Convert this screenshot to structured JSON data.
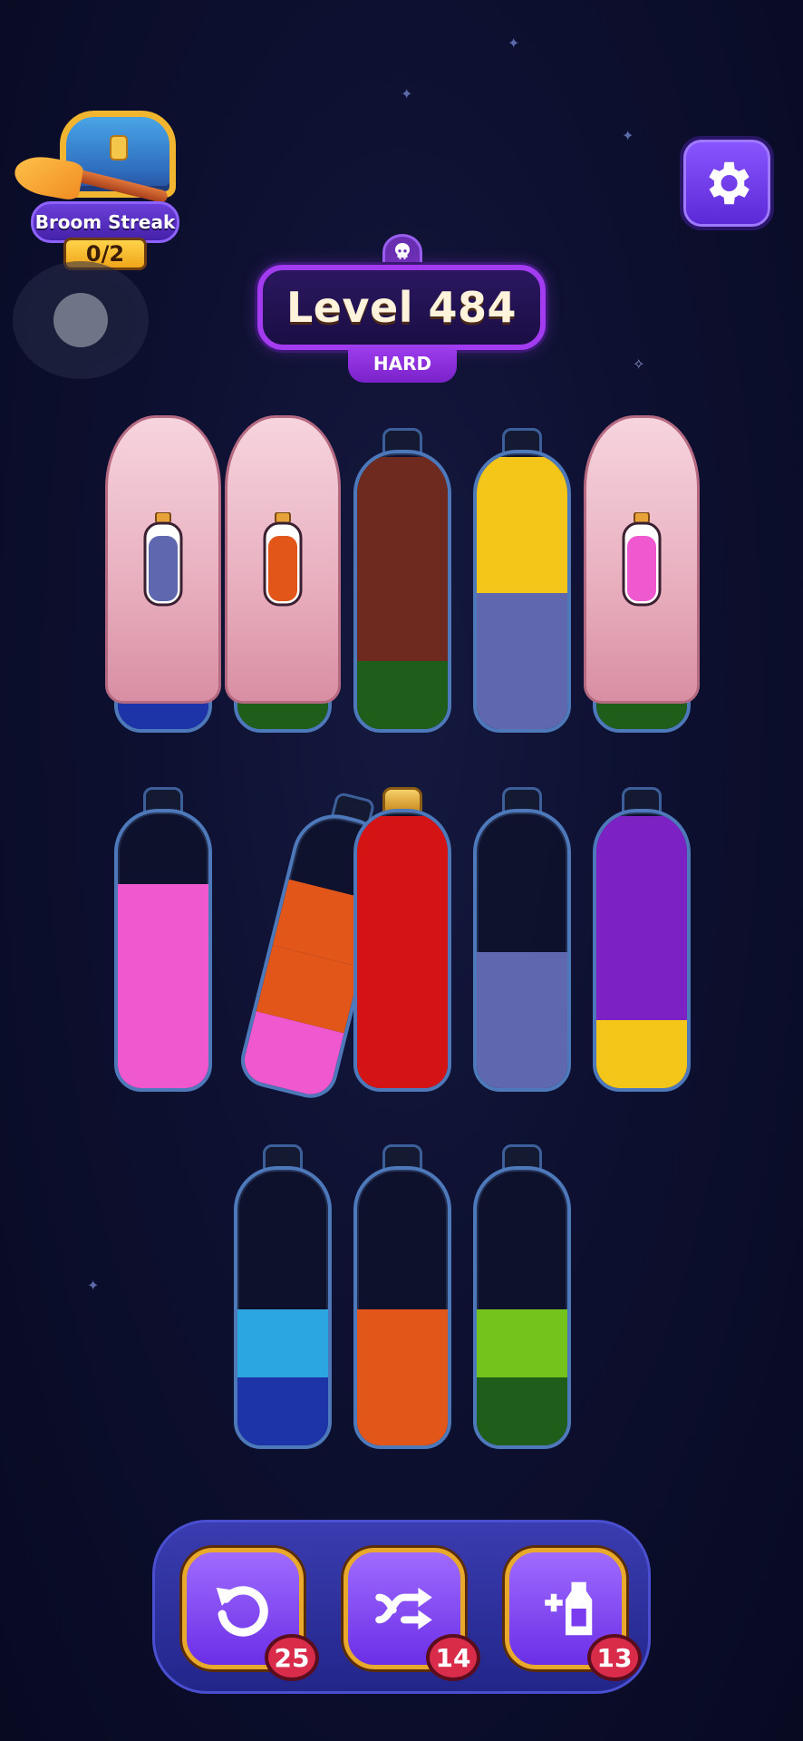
{
  "broom_streak": {
    "label": "Broom Streak",
    "progress": "0/2"
  },
  "level": {
    "title": "Level 484",
    "difficulty": "HARD"
  },
  "bottles": [
    {
      "row": 1,
      "covered": true,
      "hint_color": "#5f67ae",
      "layers": [
        "#1c34a8"
      ]
    },
    {
      "row": 1,
      "covered": true,
      "hint_color": "#e2561a",
      "layers": [
        "#1f5e1a"
      ]
    },
    {
      "row": 1,
      "covered": false,
      "layers": [
        "#1f5e1a",
        "#6e2a1e",
        "#6e2a1e",
        "#6e2a1e"
      ]
    },
    {
      "row": 1,
      "covered": false,
      "layers": [
        "#5f67ae",
        "#5f67ae",
        "#f5c61a",
        "#f5c61a"
      ]
    },
    {
      "row": 1,
      "covered": true,
      "hint_color": "#f058cf",
      "layers": [
        "#1f5e1a"
      ]
    },
    {
      "row": 2,
      "covered": false,
      "layers": [
        "#f058cf",
        "#f058cf",
        "#f058cf"
      ]
    },
    {
      "row": 2,
      "covered": false,
      "tilted": true,
      "layers": [
        "#f058cf",
        "#e2561a",
        "#e2561a"
      ]
    },
    {
      "row": 2,
      "covered": false,
      "cork": true,
      "layers": [
        "#d41414",
        "#d41414",
        "#d41414",
        "#d41414"
      ]
    },
    {
      "row": 2,
      "covered": false,
      "layers": [
        "#5f67ae",
        "#5f67ae"
      ]
    },
    {
      "row": 2,
      "covered": false,
      "layers": [
        "#f5c61a",
        "#7c22c4",
        "#7c22c4",
        "#7c22c4"
      ]
    },
    {
      "row": 3,
      "covered": false,
      "layers": [
        "#1c34a8",
        "#2ba6e0"
      ]
    },
    {
      "row": 3,
      "covered": false,
      "layers": [
        "#e2561a",
        "#e2561a"
      ]
    },
    {
      "row": 3,
      "covered": false,
      "layers": [
        "#1f5e1a",
        "#74c21c"
      ]
    }
  ],
  "tools": [
    {
      "name": "undo",
      "count": "25",
      "icon": "undo-icon"
    },
    {
      "name": "shuffle",
      "count": "14",
      "icon": "shuffle-icon"
    },
    {
      "name": "add-bottle",
      "count": "13",
      "icon": "add-bottle-icon"
    }
  ]
}
